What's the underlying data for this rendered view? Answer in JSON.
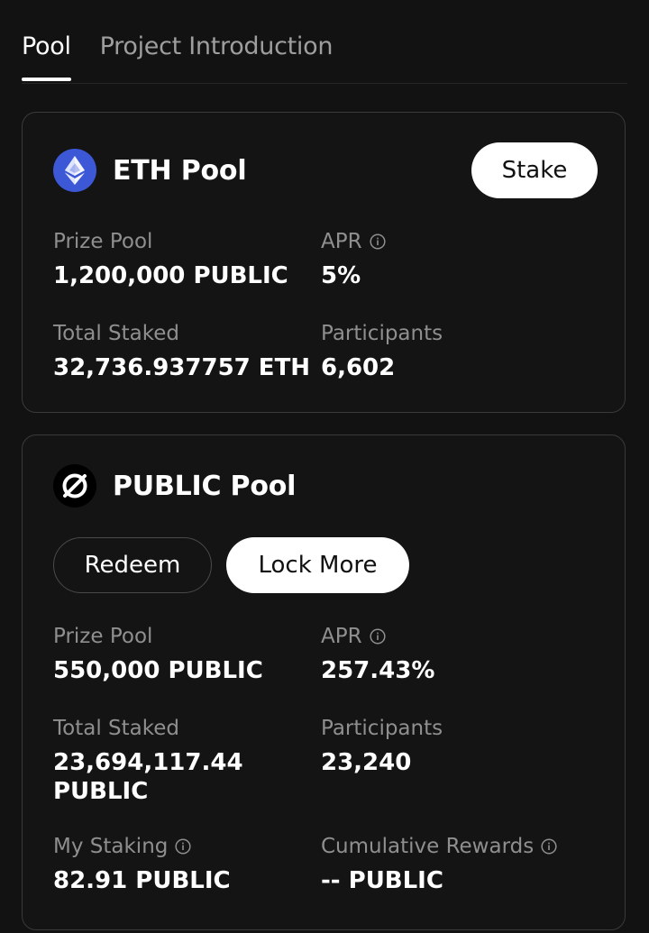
{
  "tabs": [
    {
      "label": "Pool",
      "active": true
    },
    {
      "label": "Project Introduction",
      "active": false
    }
  ],
  "eth_pool": {
    "title": "ETH Pool",
    "icon": "ethereum-icon",
    "stake_label": "Stake",
    "prize_pool_label": "Prize Pool",
    "prize_pool_value": "1,200,000 PUBLIC",
    "apr_label": "APR",
    "apr_value": "5%",
    "total_staked_label": "Total Staked",
    "total_staked_value": "32,736.937757 ETH",
    "participants_label": "Participants",
    "participants_value": "6,602"
  },
  "public_pool": {
    "title": "PUBLIC Pool",
    "icon": "public-token-icon",
    "redeem_label": "Redeem",
    "lock_more_label": "Lock More",
    "prize_pool_label": "Prize Pool",
    "prize_pool_value": "550,000 PUBLIC",
    "apr_label": "APR",
    "apr_value": "257.43%",
    "total_staked_label": "Total Staked",
    "total_staked_value": "23,694,117.44 PUBLIC",
    "participants_label": "Participants",
    "participants_value": "23,240",
    "my_staking_label": "My Staking",
    "my_staking_value": "82.91 PUBLIC",
    "cumulative_rewards_label": "Cumulative Rewards",
    "cumulative_rewards_value": "-- PUBLIC"
  },
  "colors": {
    "background": "#121212",
    "card_border": "#3a3a3a",
    "label_gray": "#8f8f8f",
    "eth_blue": "#3c58d6",
    "button_white": "#ffffff"
  }
}
